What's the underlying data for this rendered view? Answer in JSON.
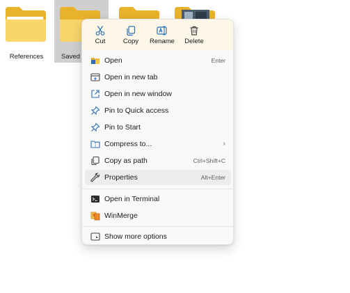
{
  "files": [
    {
      "label": "References",
      "thumbnail": "folder-icon"
    },
    {
      "label": "Saved P",
      "thumbnail": "folder-icon",
      "selected": true
    },
    {
      "label": "",
      "thumbnail": "folder-icon"
    },
    {
      "label": "",
      "thumbnail": "folder-with-preview-icon"
    }
  ],
  "quick_actions": {
    "cut": "Cut",
    "copy": "Copy",
    "rename": "Rename",
    "delete": "Delete"
  },
  "menu": {
    "open": {
      "label": "Open",
      "shortcut": "Enter"
    },
    "open_new_tab": {
      "label": "Open in new tab"
    },
    "open_new_window": {
      "label": "Open in new window"
    },
    "pin_quick_access": {
      "label": "Pin to Quick access"
    },
    "pin_start": {
      "label": "Pin to Start"
    },
    "compress": {
      "label": "Compress to..."
    },
    "copy_path": {
      "label": "Copy as path",
      "shortcut": "Ctrl+Shift+C"
    },
    "properties": {
      "label": "Properties",
      "shortcut": "Alt+Enter"
    },
    "terminal": {
      "label": "Open in Terminal"
    },
    "winmerge": {
      "label": "WinMerge"
    },
    "more_options": {
      "label": "Show more options"
    }
  },
  "colors": {
    "folder_back": "#e8b22b",
    "folder_front": "#f9d56a",
    "quick_bar_bg": "#fbf6e8",
    "menu_bg": "#f9f9f9",
    "hover_bg": "#ececec",
    "icon_blue": "#2b6fb5",
    "selected_tile": "#cfcfcf"
  }
}
